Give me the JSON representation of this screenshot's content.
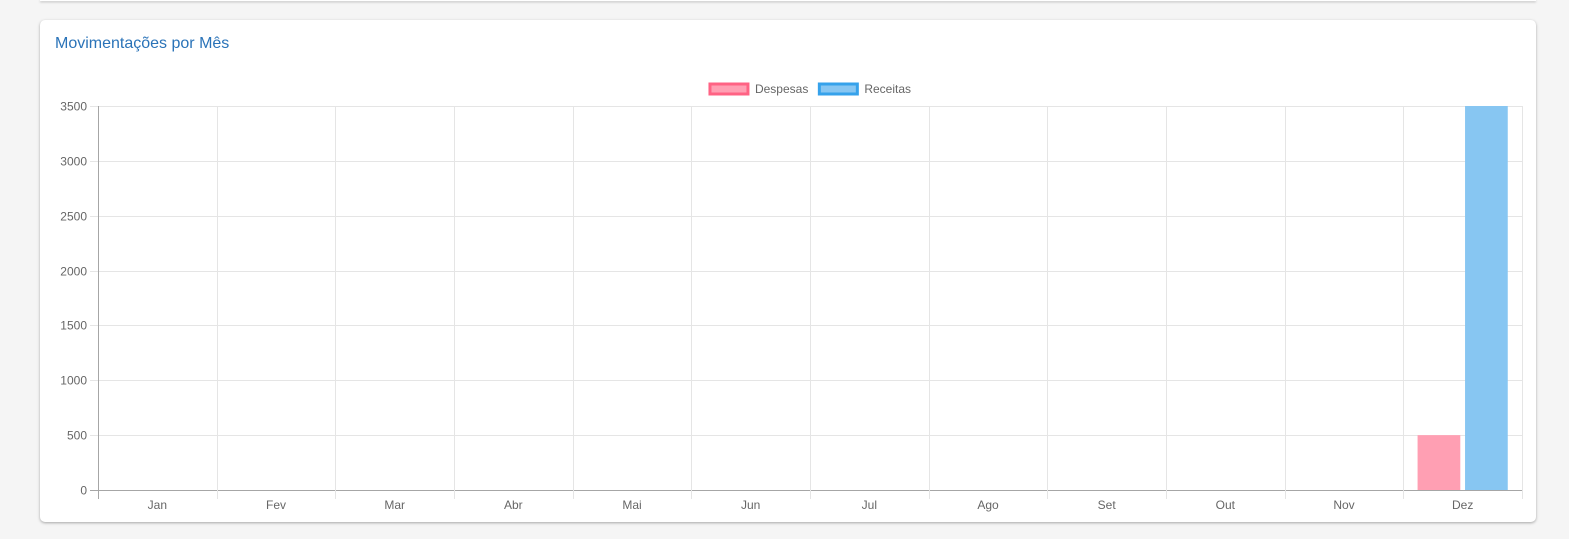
{
  "card": {
    "title": "Movimentações por Mês"
  },
  "chart_data": {
    "type": "bar",
    "categories": [
      "Jan",
      "Fev",
      "Mar",
      "Abr",
      "Mai",
      "Jun",
      "Jul",
      "Ago",
      "Set",
      "Out",
      "Nov",
      "Dez"
    ],
    "series": [
      {
        "name": "Despesas",
        "values": [
          0,
          0,
          0,
          0,
          0,
          0,
          0,
          0,
          0,
          0,
          0,
          500
        ],
        "fill": "#ff9fb3",
        "stroke": "#ff6384"
      },
      {
        "name": "Receitas",
        "values": [
          0,
          0,
          0,
          0,
          0,
          0,
          0,
          0,
          0,
          0,
          0,
          3500
        ],
        "fill": "#87c6f2",
        "stroke": "#36a2eb"
      }
    ],
    "yticks": [
      0,
      500,
      1000,
      1500,
      2000,
      2500,
      3000,
      3500
    ],
    "ylim": [
      0,
      3500
    ],
    "grid": true,
    "legend": "top-center",
    "title": "",
    "xlabel": "",
    "ylabel": ""
  }
}
